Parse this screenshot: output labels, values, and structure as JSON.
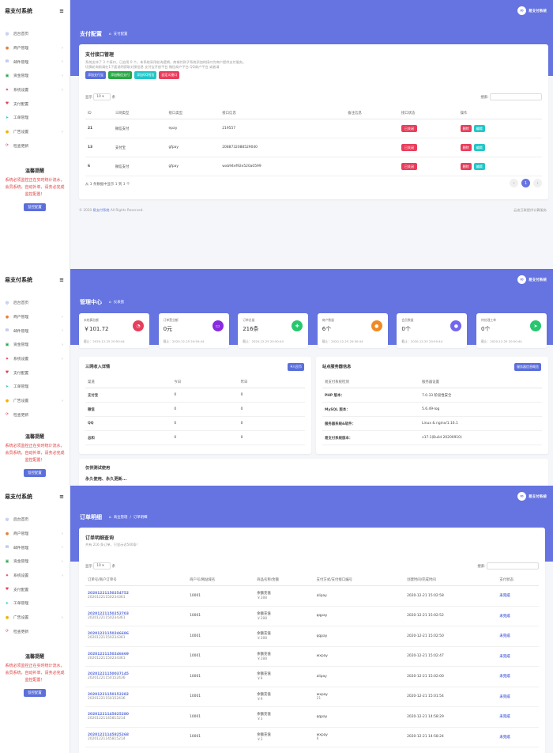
{
  "app": {
    "name": "易支付系统",
    "hero_brand": "易支付系统"
  },
  "sidebar": {
    "items": [
      {
        "label": "后台首页",
        "icon": "dashboard-icon",
        "color": "#5b6fdb",
        "arrow": false
      },
      {
        "label": "商户管理",
        "icon": "user-icon",
        "color": "#e8803a",
        "arrow": true
      },
      {
        "label": "邮件管理",
        "icon": "mail-icon",
        "color": "#5b6fdb",
        "arrow": true
      },
      {
        "label": "资金管理",
        "icon": "money-icon",
        "color": "#28a745",
        "arrow": true
      },
      {
        "label": "系统设置",
        "icon": "gear-icon",
        "color": "#e83e5c",
        "arrow": true
      },
      {
        "label": "支付配置",
        "icon": "heart-icon",
        "color": "#e83e5c",
        "arrow": false
      },
      {
        "label": "工单管理",
        "icon": "send-icon",
        "color": "#23c6c8",
        "arrow": false
      },
      {
        "label": "广告设置",
        "icon": "ad-icon",
        "color": "#f0b400",
        "arrow": true
      },
      {
        "label": "检查更新",
        "icon": "update-icon",
        "color": "#e83e5c",
        "arrow": false
      }
    ],
    "notice_title": "温馨提醒",
    "notice_body": "系统必须监控正在实时统计流水，会员系统，自动补单，请务必完成监控配置！",
    "notice_button": "监控配置"
  },
  "p1": {
    "title": "支付配置",
    "breadcrumb": "支付配置",
    "card_title": "支付接口管理",
    "desc1": "系统支持了 3 个接口，已启用 0 个。本系统采用轮询逻辑，商城付款子系统添加的接口为商户提供支付服务。",
    "desc2": "切换轮询前请在1下面说明获取对接信息    支付宝开放平台 微信商户平台 QQ商户平台 或者请",
    "buttons": [
      "添加支付宝",
      "添加微信支付",
      "添加QQ钱包",
      "自定义接口"
    ],
    "button_colors": [
      "#5b6fdb",
      "#28a745",
      "#23c6c8",
      "#e83e5c"
    ],
    "show_label": "显示",
    "show_value": "10",
    "show_unit": "条",
    "search_label": "搜索:",
    "columns": [
      "ID",
      "三网类型",
      "接口类型",
      "接口信息",
      "备注信息",
      "接口状态",
      "操作"
    ],
    "rows": [
      {
        "id": "21",
        "type": "微信支付",
        "api": "epay",
        "info": "219557",
        "status": "已关闭",
        "edit": "编辑",
        "del": "删除"
      },
      {
        "id": "13",
        "type": "支付宝",
        "api": "gfpay",
        "info": "2088732088529040",
        "status": "已关闭",
        "edit": "编辑",
        "del": "删除"
      },
      {
        "id": "6",
        "type": "微信支付",
        "api": "gfpay",
        "info": "wxb94ef92e520a0599",
        "status": "已关闭",
        "edit": "编辑",
        "del": "删除"
      }
    ],
    "summary": "从 3 条数据中显示 1 到 3 个",
    "page": "1",
    "footer_left_pre": "© 2020",
    "footer_brand": "易支付系统",
    "footer_left_post": "All Rights Reserved.",
    "footer_right": "云迪互联提供计算服务"
  },
  "p2": {
    "title": "管理中心",
    "breadcrumb": "仪表盘",
    "stats": [
      {
        "label": "未结算总额",
        "value": "￥101.72",
        "date": "截止：2020-12-25 20:50:44",
        "color": "#e83e5c",
        "icon": "◔"
      },
      {
        "label": "订单营业额",
        "value": "0元",
        "date": "截止：2020-12-25 20:50:44",
        "color": "#8a2be2",
        "icon": "▭"
      },
      {
        "label": "订单总量",
        "value": "216条",
        "date": "截止：2020-12-25 20:50:44",
        "color": "#28c76f",
        "icon": "✚"
      },
      {
        "label": "商户数量",
        "value": "6个",
        "date": "截止：2020-12-25 20:50:44",
        "color": "#f08a24",
        "icon": "●"
      },
      {
        "label": "会员数量",
        "value": "0个",
        "date": "截止：2020-12-25 20:50:44",
        "color": "#7367f0",
        "icon": "●"
      },
      {
        "label": "待处理工单",
        "value": "0个",
        "date": "截止：2020-12-25 20:50:44",
        "color": "#28c76f",
        "icon": "➤"
      }
    ],
    "left_title": "三网收入详情",
    "left_button": "¥人民币",
    "left_cols": [
      "渠道",
      "今日",
      "昨日"
    ],
    "left_rows": [
      [
        "支付宝",
        "0",
        "0"
      ],
      [
        "微信",
        "0",
        "0"
      ],
      [
        "QQ",
        "0",
        "0"
      ],
      [
        "总和",
        "0",
        "0"
      ]
    ],
    "right_title": "站点服务器信息",
    "right_button": "服务器信息概览",
    "right_cols": [
      "易支付系统检测",
      "服务器设置"
    ],
    "right_rows": [
      [
        "PHP 版本：",
        "7.0.33 阶段性安全"
      ],
      [
        "MySQL 版本：",
        "5.6.49-log"
      ],
      [
        "服务器系统&软件：",
        "Linux & nginx/1.16.1"
      ],
      [
        "易支付系统版本：",
        "v17.1(Build 20200910)"
      ]
    ],
    "bottom_title": "仅供测试使用",
    "bottom_sub": "永久使用、永久更新..."
  },
  "p3": {
    "title": "订单明细",
    "breadcrumb1": "商业管理",
    "breadcrumb2": "订单明细",
    "card_title": "订单明细查询",
    "card_sub": "共有 216 条订单，只显示近500条!",
    "show_label": "显示",
    "show_value": "10",
    "show_unit": "条",
    "search_label": "搜索:",
    "columns": [
      "订单号/商户订单号",
      "商户号/网站域名",
      "商品名称/金额",
      "支付方式/支付接口编号",
      "创建时间/完成时间",
      "支付状态"
    ],
    "rows": [
      {
        "o1": "20201221150254752",
        "o2": "20201221150234361",
        "m": "10001",
        "g": "余额充值",
        "a": "￥288",
        "p": "alipay",
        "pn": "",
        "t": "2020-12-21 15:02:58",
        "s": "未完成"
      },
      {
        "o1": "20201221150252703",
        "o2": "20201221150234361",
        "m": "10001",
        "g": "余额充值",
        "a": "￥288",
        "p": "qqpay",
        "pn": "",
        "t": "2020-12-21 15:02:52",
        "s": "未完成"
      },
      {
        "o1": "20201221150246686",
        "o2": "20201221150234361",
        "m": "10001",
        "g": "余额充值",
        "a": "￥288",
        "p": "qqpay",
        "pn": "",
        "t": "2020-12-21 15:02:50",
        "s": "未完成"
      },
      {
        "o1": "20201221150246669",
        "o2": "20201221150234361",
        "m": "10001",
        "g": "余额充值",
        "a": "￥288",
        "p": "wxpay",
        "pn": "",
        "t": "2020-12-21 15:02:47",
        "s": "未完成"
      },
      {
        "o1": "20201221150037145",
        "o2": "20201221150152436",
        "m": "10001",
        "g": "余额充值",
        "a": "￥9",
        "p": "alipay",
        "pn": "",
        "t": "2020-12-21 15:02:00",
        "s": "未完成"
      },
      {
        "o1": "20201221150152282",
        "o2": "20201221150152436",
        "m": "10001",
        "g": "余额充值",
        "a": "￥9",
        "p": "wxpay",
        "pn": "21",
        "t": "2020-12-21 15:01:54",
        "s": "未完成"
      },
      {
        "o1": "20201221145825280",
        "o2": "20201221145815214",
        "m": "10001",
        "g": "余额充值",
        "a": "￥3",
        "p": "qqpay",
        "pn": "",
        "t": "2020-12-21 14:58:29",
        "s": "未完成"
      },
      {
        "o1": "20201221145825268",
        "o2": "20201221145815214",
        "m": "10001",
        "g": "余额充值",
        "a": "￥3",
        "p": "wxpay",
        "pn": "6",
        "t": "2020-12-21 14:58:24",
        "s": "未完成"
      }
    ]
  }
}
